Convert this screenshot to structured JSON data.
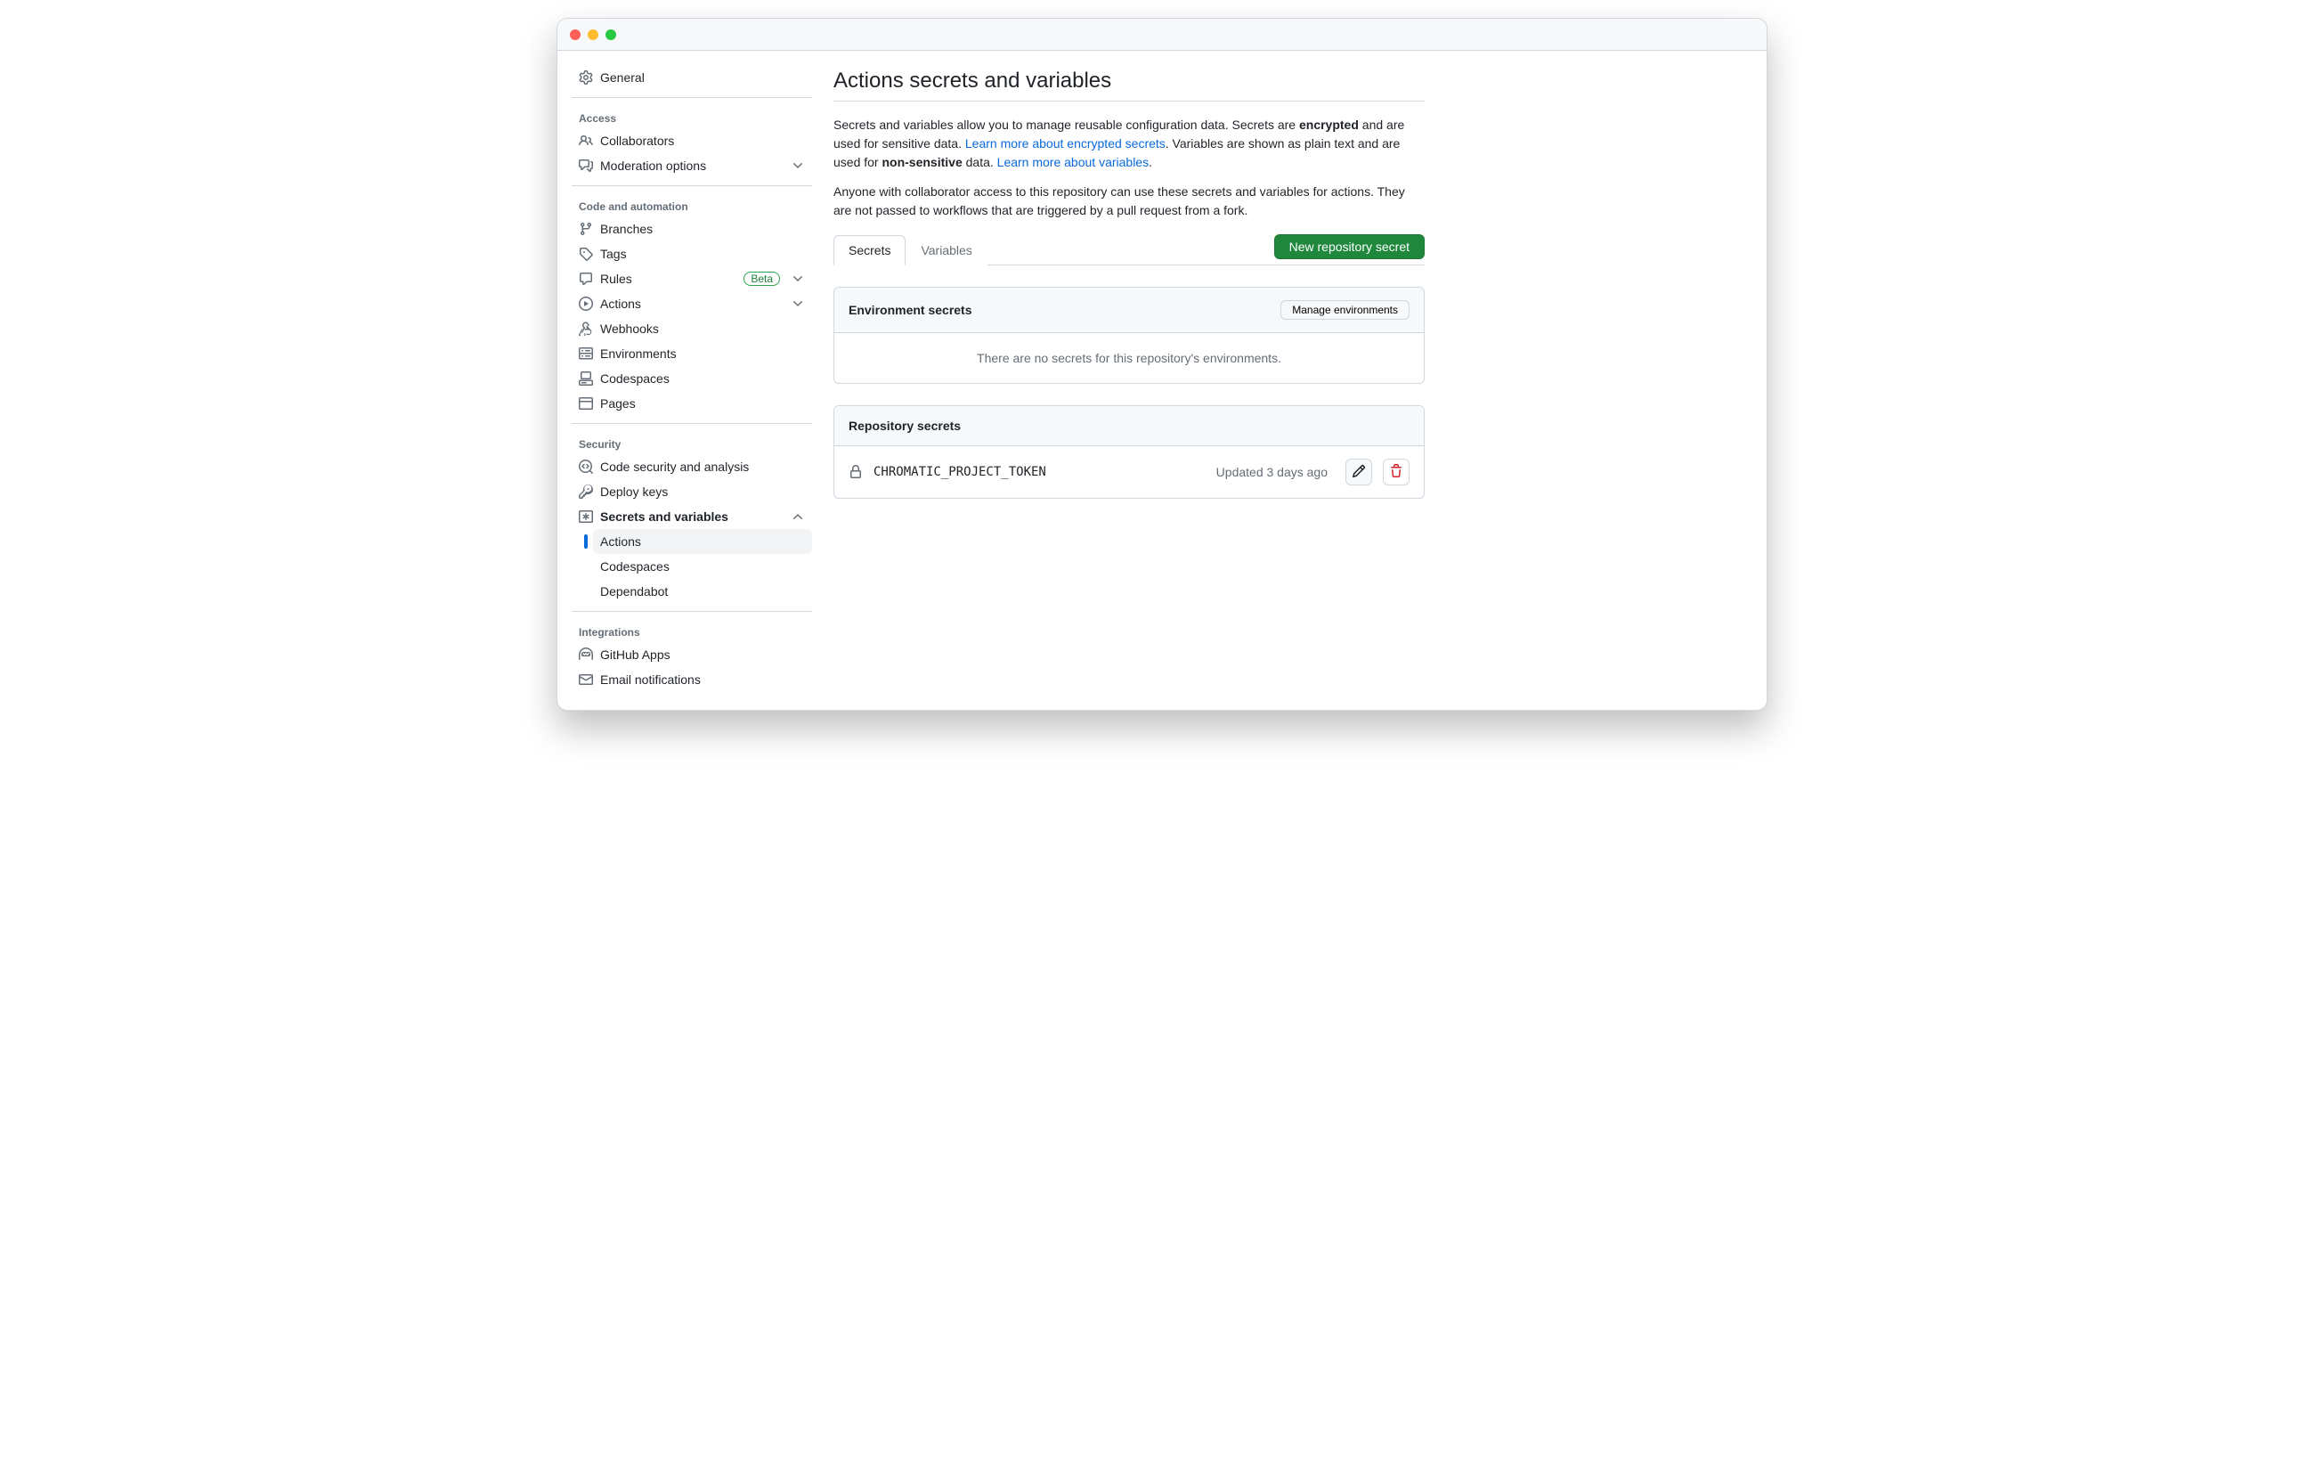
{
  "sidebar": {
    "general": "General",
    "sections": {
      "access": {
        "heading": "Access",
        "collaborators": "Collaborators",
        "moderation": "Moderation options"
      },
      "code": {
        "heading": "Code and automation",
        "branches": "Branches",
        "tags": "Tags",
        "rules": "Rules",
        "rules_badge": "Beta",
        "actions": "Actions",
        "webhooks": "Webhooks",
        "environments": "Environments",
        "codespaces": "Codespaces",
        "pages": "Pages"
      },
      "security": {
        "heading": "Security",
        "code_security": "Code security and analysis",
        "deploy_keys": "Deploy keys",
        "secrets": "Secrets and variables",
        "sub": {
          "actions": "Actions",
          "codespaces": "Codespaces",
          "dependabot": "Dependabot"
        }
      },
      "integrations": {
        "heading": "Integrations",
        "github_apps": "GitHub Apps",
        "email": "Email notifications"
      }
    }
  },
  "main": {
    "title": "Actions secrets and variables",
    "desc_1_a": "Secrets and variables allow you to manage reusable configuration data. Secrets are ",
    "desc_1_bold1": "encrypted",
    "desc_1_b": " and are used for sensitive data. ",
    "desc_1_link1": "Learn more about encrypted secrets",
    "desc_1_c": ". Variables are shown as plain text and are used for ",
    "desc_1_bold2": "non-sensitive",
    "desc_1_d": " data. ",
    "desc_1_link2": "Learn more about variables",
    "desc_1_e": ".",
    "desc_2": "Anyone with collaborator access to this repository can use these secrets and variables for actions. They are not passed to workflows that are triggered by a pull request from a fork.",
    "tabs": {
      "secrets": "Secrets",
      "variables": "Variables"
    },
    "new_secret_btn": "New repository secret",
    "env_panel": {
      "title": "Environment secrets",
      "manage_btn": "Manage environments",
      "empty": "There are no secrets for this repository's environments."
    },
    "repo_panel": {
      "title": "Repository secrets",
      "secrets": [
        {
          "name": "CHROMATIC_PROJECT_TOKEN",
          "updated": "Updated 3 days ago"
        }
      ]
    }
  }
}
